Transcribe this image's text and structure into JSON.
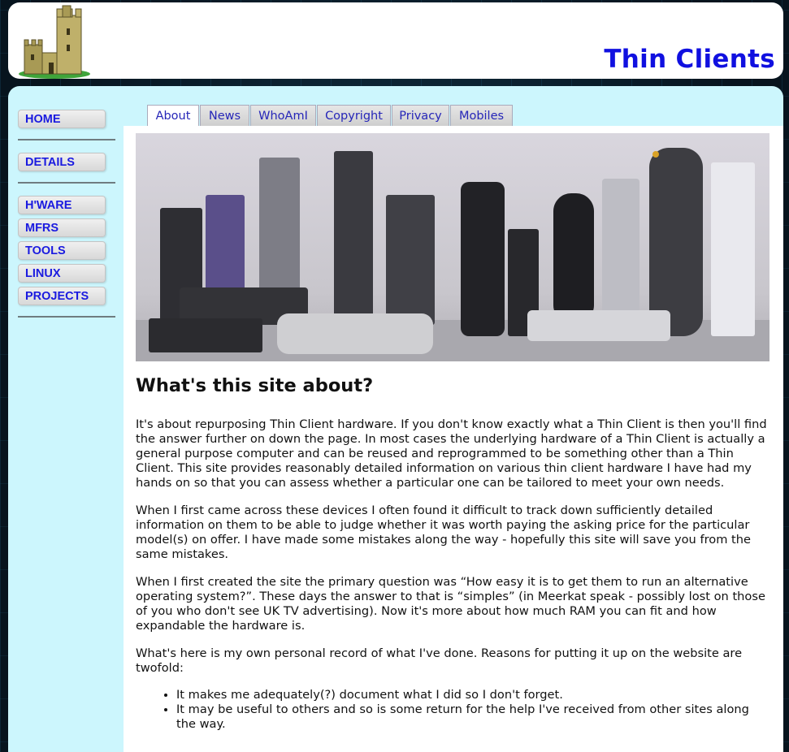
{
  "header": {
    "site_title": "Thin Clients",
    "logo_icon": "castle-icon"
  },
  "nav": {
    "top": [
      {
        "label": "HOME"
      }
    ],
    "middle": [
      {
        "label": "DETAILS"
      }
    ],
    "bottom": [
      {
        "label": "H'WARE"
      },
      {
        "label": "MFRS"
      },
      {
        "label": "TOOLS"
      },
      {
        "label": "LINUX"
      },
      {
        "label": "PROJECTS"
      }
    ]
  },
  "tabs": [
    {
      "label": "About"
    },
    {
      "label": "News"
    },
    {
      "label": "WhoAmI"
    },
    {
      "label": "Copyright"
    },
    {
      "label": "Privacy"
    },
    {
      "label": "Mobiles"
    }
  ],
  "main": {
    "heading": "What's this site about?",
    "paragraphs": [
      "It's about repurposing Thin Client hardware. If you don't know exactly what a Thin Client is then you'll find the answer further on down the page. In most cases the underlying hardware of a Thin Client is actually a general purpose computer and can be reused and reprogrammed to be something other than a Thin Client. This site provides reasonably detailed information on various thin client hardware I have had my hands on so that you can assess whether a particular one can be tailored to meet your own needs.",
      "When I first came across these devices I often found it difficult to track down sufficiently detailed information on them to be able to judge whether it was worth paying the asking price for the particular model(s) on offer. I have made some mistakes along the way - hopefully this site will save you from the same mistakes.",
      "When I first created the site the primary question was “How easy it is to get them to run an alternative operating system?”. These days the answer to that is “simples” (in Meerkat speak - possibly lost on those of you who don't see UK TV advertising). Now it's more about how much RAM you can fit and how expandable the hardware is.",
      "What's here is my own personal record of what I've done. Reasons for putting it up on the website are twofold:"
    ],
    "bullets": [
      "It makes me adequately(?) document what I did so I don't forget.",
      "It may be useful to others and so is some return for the help I've received from other sites along the way."
    ]
  },
  "colors": {
    "title": "#1010e0",
    "panel": "#ccf6fd",
    "link": "#1a1ae0"
  }
}
